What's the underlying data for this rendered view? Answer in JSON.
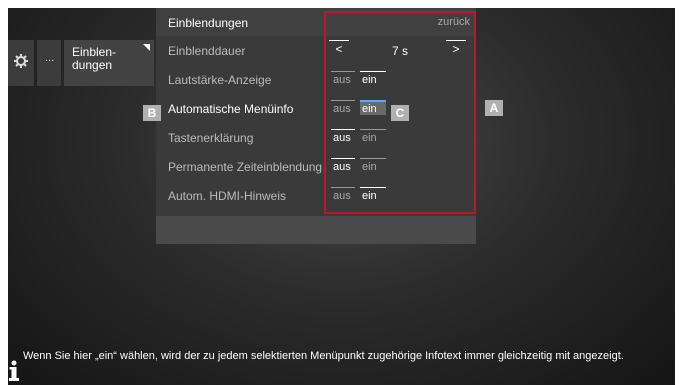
{
  "nav": {
    "dots_label": "...",
    "menu_label_line1": "Einblen-",
    "menu_label_line2": "dungen"
  },
  "panel": {
    "title": "Einblendungen",
    "back_label": "zurück",
    "duration": {
      "label": "Einblenddauer",
      "value": "7 s",
      "left_arrow": "<",
      "right_arrow": ">"
    },
    "rows": [
      {
        "label": "Lautstärke-Anzeige",
        "aus": "aus",
        "ein": "ein",
        "selected": "ein"
      },
      {
        "label": "Automatische Menüinfo",
        "aus": "aus",
        "ein": "ein",
        "selected": "ein"
      },
      {
        "label": "Tastenerklärung",
        "aus": "aus",
        "ein": "ein",
        "selected": "aus"
      },
      {
        "label": "Permanente Zeiteinblendung",
        "aus": "aus",
        "ein": "ein",
        "selected": "aus"
      },
      {
        "label": "Autom. HDMI-Hinweis",
        "aus": "aus",
        "ein": "ein",
        "selected": "ein"
      }
    ]
  },
  "callouts": {
    "a": "A",
    "b": "B",
    "c": "C"
  },
  "info": "Wenn Sie hier „ein“ wählen, wird der zu jedem selektierten Menüpunkt zugehörige Infotext immer gleichzeitig mit angezeigt.",
  "colors": {
    "annotation": "#c0162a",
    "focus": "#58a8ff"
  }
}
